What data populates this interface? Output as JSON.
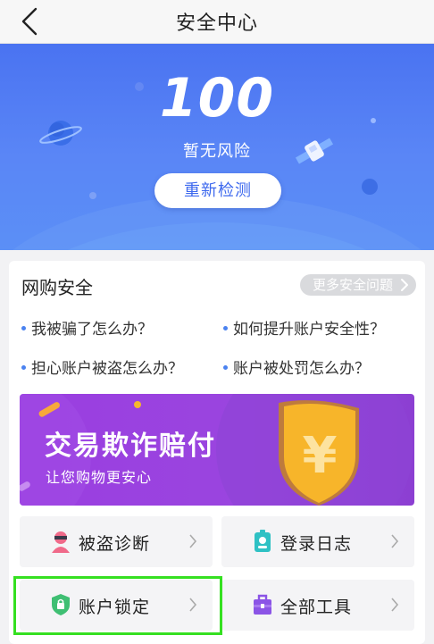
{
  "header": {
    "title": "安全中心",
    "back_icon": "chevron-left-icon"
  },
  "hero": {
    "score": "100",
    "risk_text": "暂无风险",
    "recheck_label": "重新检测",
    "bg_color": "#4f7cf3"
  },
  "shopping_security": {
    "title": "网购安全",
    "more_label": "更多安全问题",
    "questions": [
      "我被骗了怎么办？",
      "如何提升账户安全性？",
      "担心账户被盗怎么办？",
      "账户被处罚怎么办？"
    ]
  },
  "banner": {
    "title": "交易欺诈赔付",
    "subtitle": "让您购物更安心",
    "symbol": "¥"
  },
  "tools": [
    {
      "label": "被盗诊断",
      "icon": "thief-icon"
    },
    {
      "label": "登录日志",
      "icon": "badge-icon"
    },
    {
      "label": "账户锁定",
      "icon": "shield-lock-icon"
    },
    {
      "label": "全部工具",
      "icon": "toolbox-icon"
    }
  ],
  "colors": {
    "accent": "#3e69ee",
    "highlight": "#35e021",
    "banner": "#9a3ee0",
    "shield_gold": "#f7b52a"
  }
}
